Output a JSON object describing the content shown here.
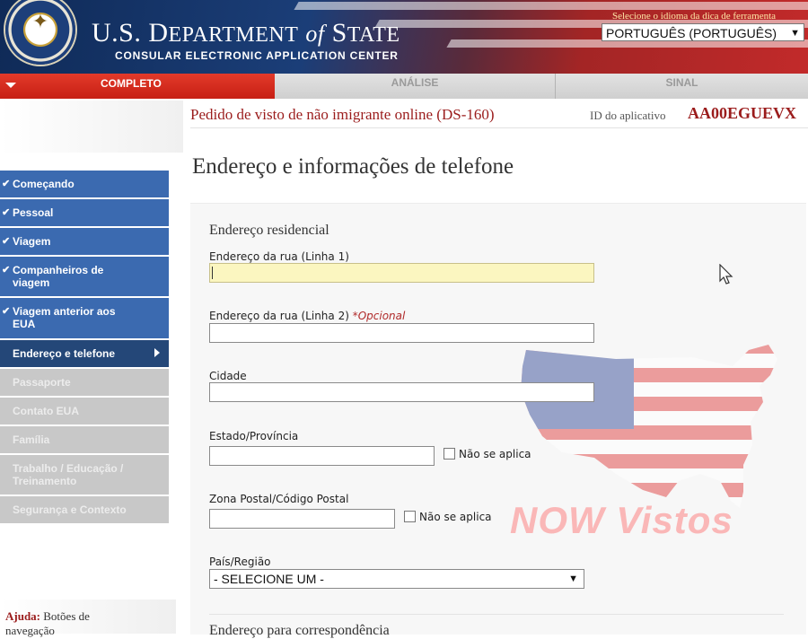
{
  "header": {
    "title_pre": "U.S. D",
    "title_dept": "EPARTMENT",
    "title_of": "of",
    "title_state": "S",
    "title_state_rest": "TATE",
    "subtitle": "CONSULAR ELECTRONIC APPLICATION CENTER",
    "language_label": "Selecione o idioma da dica de ferramenta",
    "language_selected": "PORTUGUÊS (PORTUGUÊS)"
  },
  "progress": {
    "completed_label": "COMPLETO",
    "review_label": "ANÁLISE",
    "sign_label": "SINAL"
  },
  "application": {
    "title": "Pedido de visto de não imigrante online (DS-160)",
    "id_label": "ID do aplicativo",
    "id_value": "AA00EGUEVX"
  },
  "sidebar": {
    "items": [
      {
        "label": "Começando",
        "status": "done"
      },
      {
        "label": "Pessoal",
        "status": "done"
      },
      {
        "label": "Viagem",
        "status": "done"
      },
      {
        "label": "Companheiros de viagem",
        "status": "done"
      },
      {
        "label": "Viagem anterior aos EUA",
        "status": "done"
      },
      {
        "label": "Endereço e telefone",
        "status": "current"
      },
      {
        "label": "Passaporte",
        "status": "todo"
      },
      {
        "label": "Contato EUA",
        "status": "todo"
      },
      {
        "label": "Família",
        "status": "todo"
      },
      {
        "label": "Trabalho / Educação / Treinamento",
        "status": "todo"
      },
      {
        "label": "Segurança e Contexto",
        "status": "todo"
      }
    ],
    "help_label": "Ajuda:",
    "help_text": "Botões de navegação"
  },
  "main": {
    "page_title": "Endereço e informações de telefone",
    "section_title": "Endereço residencial",
    "street1_label": "Endereço da rua (Linha 1)",
    "street2_label": "Endereço da rua (Linha 2)",
    "optional_marker": "*Opcional",
    "city_label": "Cidade",
    "state_label": "Estado/Província",
    "postal_label": "Zona Postal/Código Postal",
    "not_applicable": "Não se aplica",
    "country_label": "País/Região",
    "country_selected": "- SELECIONE UM -",
    "next_section_title": "Endereço para correspondência",
    "fields": {
      "street1": "",
      "street2": "",
      "city": "",
      "state": "",
      "postal": ""
    }
  },
  "watermark": {
    "text": "NOW Vistos"
  },
  "colors": {
    "header_blue": "#1b3e78",
    "header_red": "#c22a2a",
    "nav_done": "#3b6ab0",
    "nav_current": "#244778",
    "nav_todo": "#c8c8c8",
    "accent_red": "#9b1c1c",
    "focus_field": "#fbf6c0"
  }
}
